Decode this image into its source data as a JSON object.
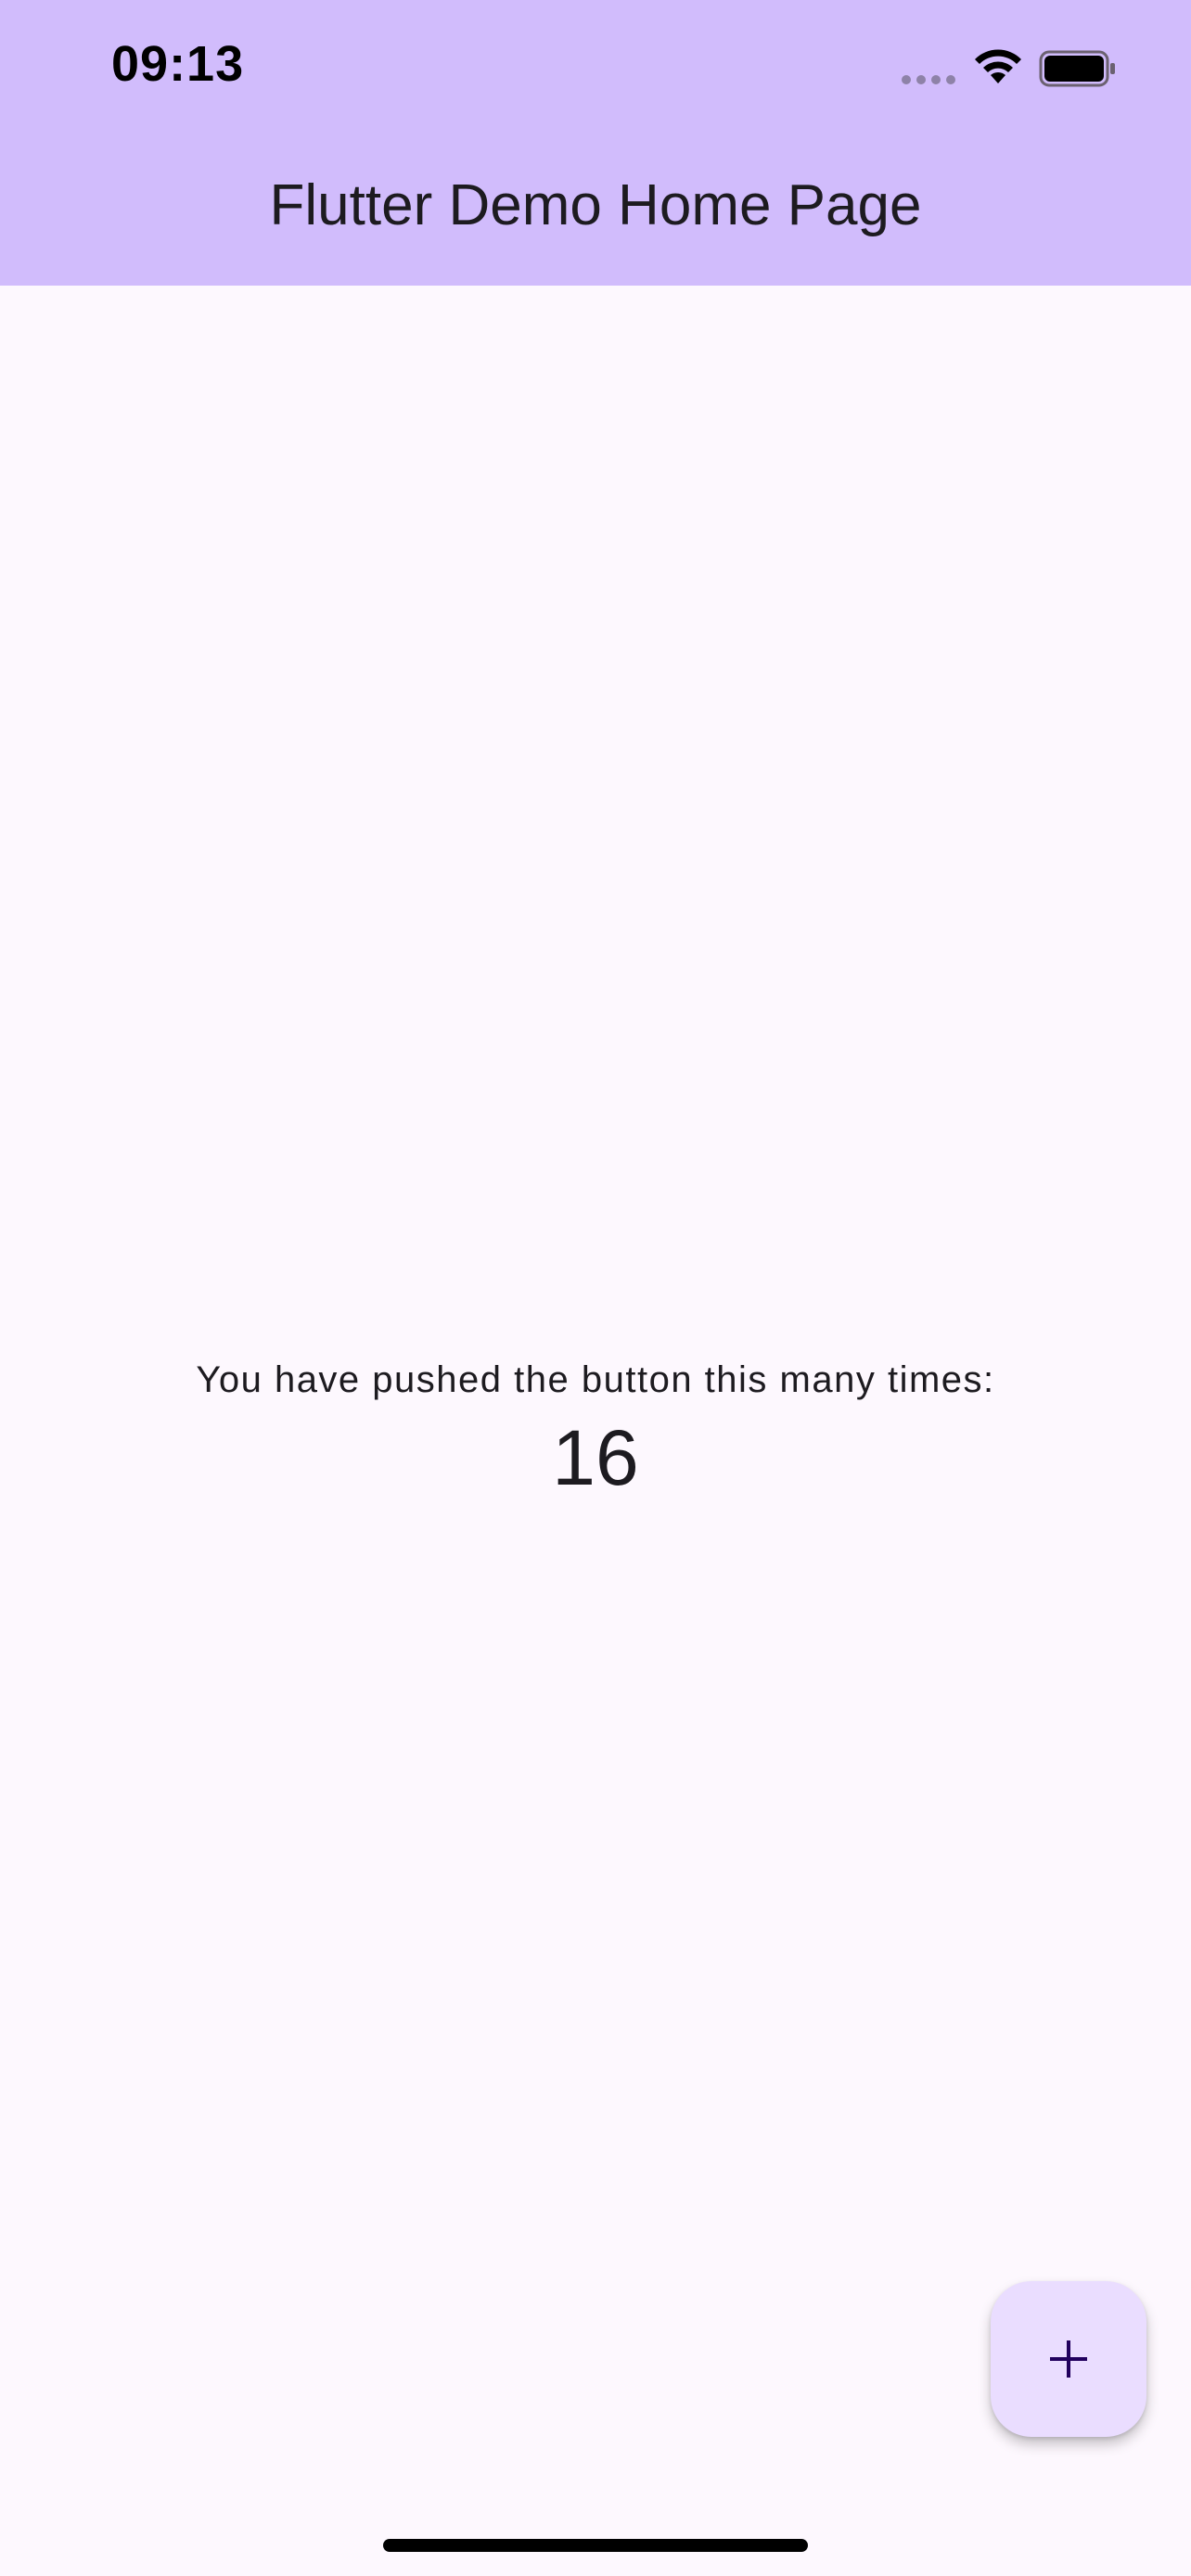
{
  "status_bar": {
    "time": "09:13",
    "icons": [
      "cellular-signal-icon",
      "wifi-icon",
      "battery-icon"
    ]
  },
  "app_bar": {
    "title": "Flutter Demo Home Page",
    "background": "#D1BCFC"
  },
  "body": {
    "label": "You have pushed the button this many times:",
    "counter": "16",
    "background": "#FDF8FE"
  },
  "fab": {
    "icon": "add-icon",
    "background": "#EADDFF",
    "icon_color": "#21005D"
  }
}
